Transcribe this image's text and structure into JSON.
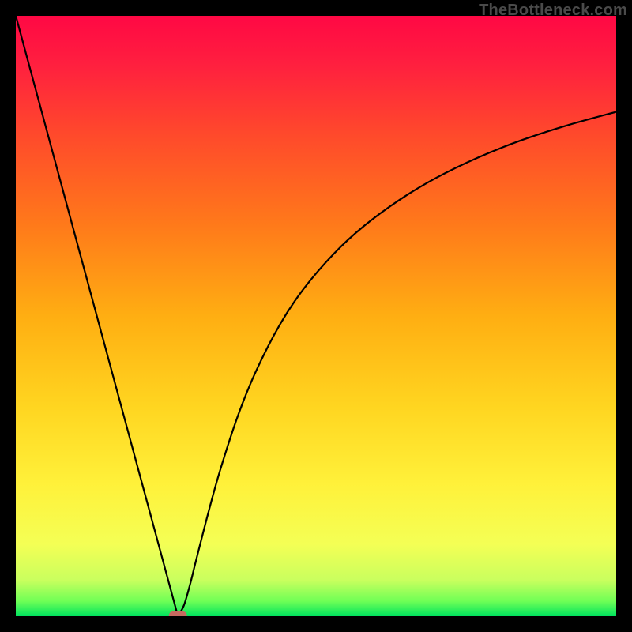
{
  "attribution": "TheBottleneck.com",
  "chart_data": {
    "type": "line",
    "title": "",
    "xlabel": "",
    "ylabel": "",
    "xlim": [
      0,
      100
    ],
    "ylim": [
      0,
      100
    ],
    "grid": false,
    "legend": false,
    "background": {
      "type": "vertical-gradient",
      "description": "Smooth gradient from red at top through orange, yellow, to green at bottom, representing bottleneck severity (red = high, green = low).",
      "stops": [
        {
          "pos": 0.0,
          "color": "#ff0844"
        },
        {
          "pos": 0.08,
          "color": "#ff1f3f"
        },
        {
          "pos": 0.2,
          "color": "#ff4a2b"
        },
        {
          "pos": 0.35,
          "color": "#ff7a1a"
        },
        {
          "pos": 0.5,
          "color": "#ffae12"
        },
        {
          "pos": 0.65,
          "color": "#ffd520"
        },
        {
          "pos": 0.78,
          "color": "#fff13a"
        },
        {
          "pos": 0.88,
          "color": "#f4ff55"
        },
        {
          "pos": 0.94,
          "color": "#c9ff5e"
        },
        {
          "pos": 0.975,
          "color": "#6fff56"
        },
        {
          "pos": 1.0,
          "color": "#00e35e"
        }
      ]
    },
    "series": [
      {
        "name": "bottleneck-curve",
        "description": "V-shaped curve: steep linear descent from top-left to a minimum near x≈27, then asymptotic rise toward the right.",
        "color": "#000000",
        "x": [
          0,
          2,
          5,
          8,
          11,
          14,
          17,
          20,
          23,
          25,
          27,
          28,
          29,
          30,
          32,
          34,
          37,
          40,
          44,
          48,
          53,
          58,
          64,
          70,
          77,
          84,
          92,
          100
        ],
        "y": [
          100,
          92.6,
          81.5,
          70.4,
          59.3,
          48.1,
          37.0,
          25.9,
          14.8,
          7.4,
          0,
          1.8,
          5.2,
          9.2,
          17.0,
          24.2,
          33.4,
          40.8,
          48.6,
          54.6,
          60.4,
          65.0,
          69.4,
          73.0,
          76.4,
          79.2,
          81.8,
          84.0
        ]
      }
    ],
    "markers": [
      {
        "name": "optimal-point",
        "shape": "rounded-rect",
        "x": 27,
        "y": 0,
        "width_pct": 3.0,
        "height_pct": 1.6,
        "color": "#c66a60"
      }
    ]
  }
}
